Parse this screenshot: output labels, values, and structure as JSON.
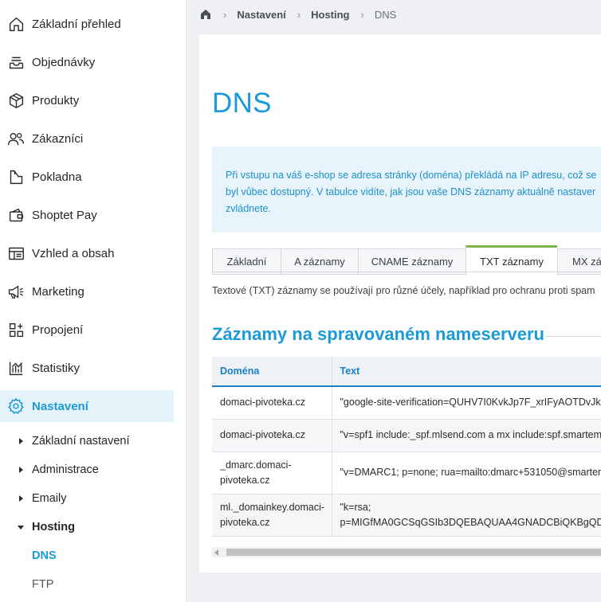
{
  "sidebar": {
    "items": [
      {
        "label": "Základní přehled",
        "icon": "home-icon"
      },
      {
        "label": "Objednávky",
        "icon": "orders-icon"
      },
      {
        "label": "Produkty",
        "icon": "box-icon"
      },
      {
        "label": "Zákazníci",
        "icon": "users-icon"
      },
      {
        "label": "Pokladna",
        "icon": "cash-register-icon"
      },
      {
        "label": "Shoptet Pay",
        "icon": "wallet-icon"
      },
      {
        "label": "Vzhled a obsah",
        "icon": "layout-icon"
      },
      {
        "label": "Marketing",
        "icon": "megaphone-icon"
      },
      {
        "label": "Propojení",
        "icon": "integrations-icon"
      },
      {
        "label": "Statistiky",
        "icon": "chart-icon"
      },
      {
        "label": "Nastavení",
        "icon": "gear-icon"
      }
    ],
    "sub_items": [
      {
        "label": "Základní nastavení"
      },
      {
        "label": "Administrace"
      },
      {
        "label": "Emaily"
      },
      {
        "label": "Hosting"
      },
      {
        "label": "DNS"
      },
      {
        "label": "FTP"
      }
    ]
  },
  "breadcrumb": {
    "items": [
      "Nastavení",
      "Hosting"
    ],
    "current": "DNS"
  },
  "main": {
    "title": "DNS",
    "info_lines": [
      "Při vstupu na váš e-shop se adresa stránky (doména) překládá na IP adresu, což se",
      "byl vůbec dostupný. V tabulce vidíte, jak jsou vaše DNS záznamy aktuálně nastaver",
      "zvládnete."
    ],
    "tabs": [
      "Základní",
      "A záznamy",
      "CNAME záznamy",
      "TXT záznamy",
      "MX zá"
    ],
    "active_tab": "TXT záznamy",
    "description": "Textové (TXT) záznamy se používají pro různé účely, například pro ochranu proti spam",
    "section_title": "Záznamy na spravovaném nameserveru",
    "table": {
      "headers": [
        "Doména",
        "Text"
      ],
      "rows": [
        {
          "domain": "domaci-pivoteka.cz",
          "text": "\"google-site-verification=QUHV7I0KvkJp7F_xrIFyAOTDvJk"
        },
        {
          "domain": "domaci-pivoteka.cz",
          "text": "\"v=spf1 include:_spf.mlsend.com a mx include:spf.smartem"
        },
        {
          "domain": "_dmarc.domaci-pivoteka.cz",
          "text": "\"v=DMARC1; p=none; rua=mailto:dmarc+531050@smarten"
        },
        {
          "domain": "ml._domainkey.domaci-pivoteka.cz",
          "text": "\"k=rsa;",
          "text2": "p=MIGfMA0GCSqGSIb3DQEBAQUAA4GNADCBiQKBgQDD"
        }
      ]
    }
  },
  "colors": {
    "accent": "#1b9ad6",
    "active_tab_border": "#7ab648",
    "info_bg": "#e8f4fb"
  }
}
